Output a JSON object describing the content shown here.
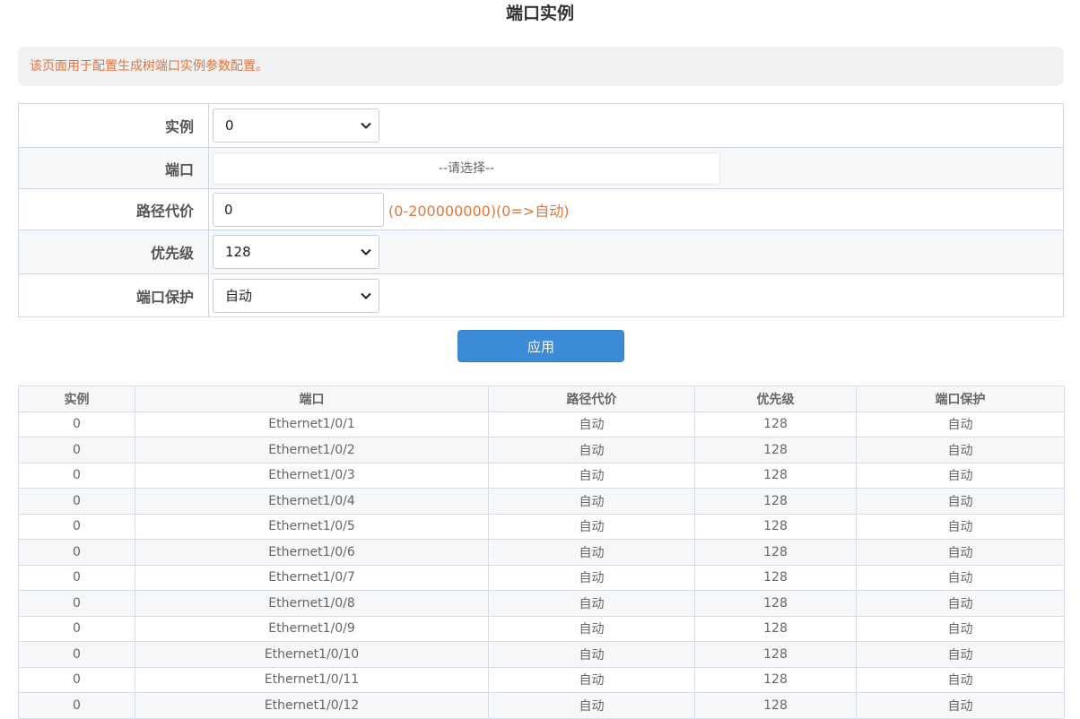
{
  "page": {
    "title": "端口实例",
    "info": "该页面用于配置生成树端口实例参数配置。"
  },
  "form": {
    "instance": {
      "label": "实例",
      "value": "0"
    },
    "port": {
      "label": "端口",
      "placeholder": "--请选择--"
    },
    "path_cost": {
      "label": "路径代价",
      "value": "0",
      "hint": "(0-200000000)(0=>自动)"
    },
    "priority": {
      "label": "优先级",
      "value": "128"
    },
    "port_protection": {
      "label": "端口保护",
      "value": "自动"
    },
    "apply_label": "应用"
  },
  "table": {
    "headers": [
      "实例",
      "端口",
      "路径代价",
      "优先级",
      "端口保护"
    ],
    "rows": [
      [
        "0",
        "Ethernet1/0/1",
        "自动",
        "128",
        "自动"
      ],
      [
        "0",
        "Ethernet1/0/2",
        "自动",
        "128",
        "自动"
      ],
      [
        "0",
        "Ethernet1/0/3",
        "自动",
        "128",
        "自动"
      ],
      [
        "0",
        "Ethernet1/0/4",
        "自动",
        "128",
        "自动"
      ],
      [
        "0",
        "Ethernet1/0/5",
        "自动",
        "128",
        "自动"
      ],
      [
        "0",
        "Ethernet1/0/6",
        "自动",
        "128",
        "自动"
      ],
      [
        "0",
        "Ethernet1/0/7",
        "自动",
        "128",
        "自动"
      ],
      [
        "0",
        "Ethernet1/0/8",
        "自动",
        "128",
        "自动"
      ],
      [
        "0",
        "Ethernet1/0/9",
        "自动",
        "128",
        "自动"
      ],
      [
        "0",
        "Ethernet1/0/10",
        "自动",
        "128",
        "自动"
      ],
      [
        "0",
        "Ethernet1/0/11",
        "自动",
        "128",
        "自动"
      ],
      [
        "0",
        "Ethernet1/0/12",
        "自动",
        "128",
        "自动"
      ]
    ]
  },
  "colors": {
    "accent_button": "#3c8bd9",
    "hint_text": "#e0763a",
    "border": "#ced6e6"
  }
}
